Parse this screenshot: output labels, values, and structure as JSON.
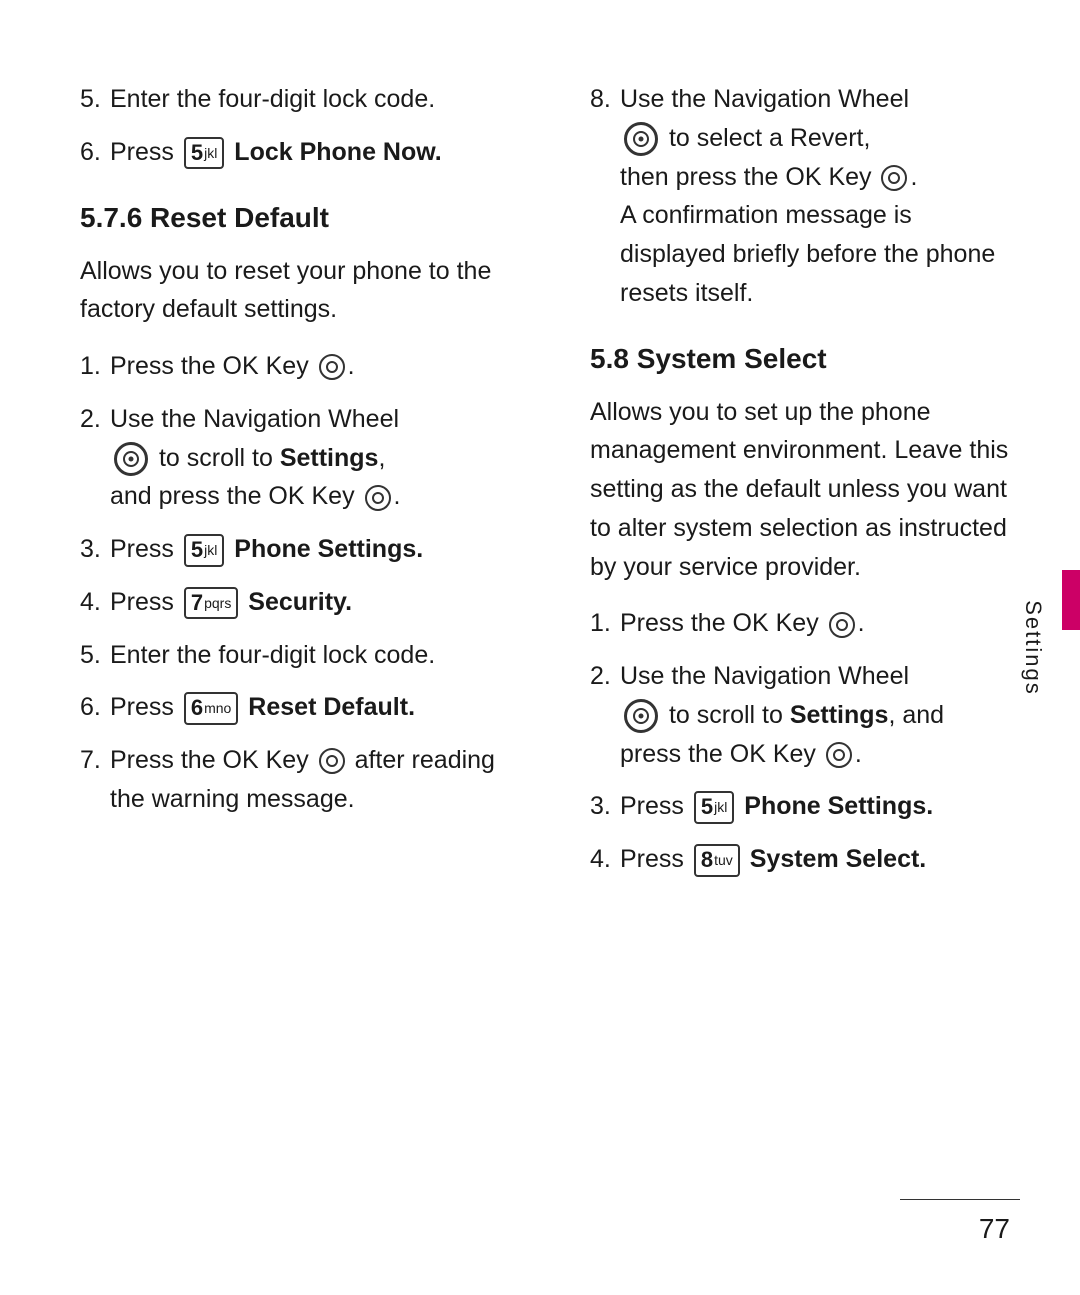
{
  "left": {
    "item5": {
      "num": "5.",
      "text": "Enter the four-digit lock code."
    },
    "item6": {
      "num": "6.",
      "prefix": "Press ",
      "key_num": "5",
      "key_sub": "jkl",
      "label": " Lock Phone Now.",
      "label_bold": "Lock Phone Now."
    },
    "section576": {
      "heading": "5.7.6 Reset Default"
    },
    "body_text": "Allows you to reset your phone to the factory default settings.",
    "items": [
      {
        "num": "1.",
        "text": "Press the OK Key "
      },
      {
        "num": "2.",
        "line1": "Use the Navigation Wheel",
        "line2": " to scroll to ",
        "settings_bold": "Settings",
        "line3": ",",
        "line4": "and press the OK Key "
      },
      {
        "num": "3.",
        "prefix": "Press ",
        "key_num": "5",
        "key_sub": "jkl",
        "label_bold": "Phone Settings."
      },
      {
        "num": "4.",
        "prefix": "Press ",
        "key_num": "7",
        "key_sub": "pqrs",
        "label_bold": "Security."
      },
      {
        "num": "5.",
        "text": "Enter the four-digit lock code."
      },
      {
        "num": "6.",
        "prefix": "Press ",
        "key_num": "6",
        "key_sub": "mno",
        "label_bold": "Reset Default."
      },
      {
        "num": "7.",
        "line1": "Press the OK Key ",
        "line2": " after reading the warning message."
      }
    ]
  },
  "right": {
    "item8": {
      "num": "8.",
      "line1": "Use the Navigation Wheel",
      "line2": " to select a Revert,",
      "line3": "then press the OK Key ",
      "line4": ".",
      "line5": "A confirmation message is displayed briefly before the phone resets itself."
    },
    "section58": {
      "heading": "5.8 System Select"
    },
    "body_text": "Allows you to set up the phone management environment. Leave this setting as the default unless you want to alter system selection as instructed by your service provider.",
    "items": [
      {
        "num": "1.",
        "text": "Press the OK Key "
      },
      {
        "num": "2.",
        "line1": "Use the Navigation Wheel",
        "line2": " to scroll to ",
        "settings_bold": "Settings",
        "line3": ", and",
        "line4": "press the OK Key "
      },
      {
        "num": "3.",
        "prefix": "Press ",
        "key_num": "5",
        "key_sub": "jkl",
        "label_bold": "Phone Settings."
      },
      {
        "num": "4.",
        "prefix": "Press ",
        "key_num": "8",
        "key_sub": "tuv",
        "label_bold": "System Select."
      }
    ]
  },
  "sidebar": {
    "label": "Settings"
  },
  "footer": {
    "page_number": "77"
  }
}
